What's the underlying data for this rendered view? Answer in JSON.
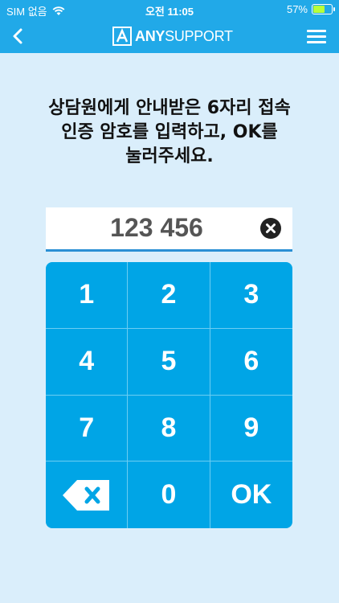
{
  "status_bar": {
    "carrier": "SIM 없음",
    "time": "오전 11:05",
    "battery_percent": "57%",
    "battery_level": 0.57
  },
  "header": {
    "logo_text_bold": "ANY",
    "logo_text_light": "SUPPORT",
    "back_icon": "chevron-left-icon",
    "menu_icon": "hamburger-menu-icon"
  },
  "instruction": {
    "line1": "상담원에게 안내받은 6자리 접속",
    "line2": "인증 암호를 입력하고, OK를",
    "line3": "눌러주세요."
  },
  "code_input": {
    "value": "123 456"
  },
  "keypad": {
    "keys": [
      "1",
      "2",
      "3",
      "4",
      "5",
      "6",
      "7",
      "8",
      "9",
      "",
      "0",
      "OK"
    ]
  },
  "colors": {
    "header_bg": "#21a9e8",
    "page_bg": "#daeefb",
    "keypad_bg": "#00a5e6",
    "input_underline": "#2a8fd4"
  }
}
